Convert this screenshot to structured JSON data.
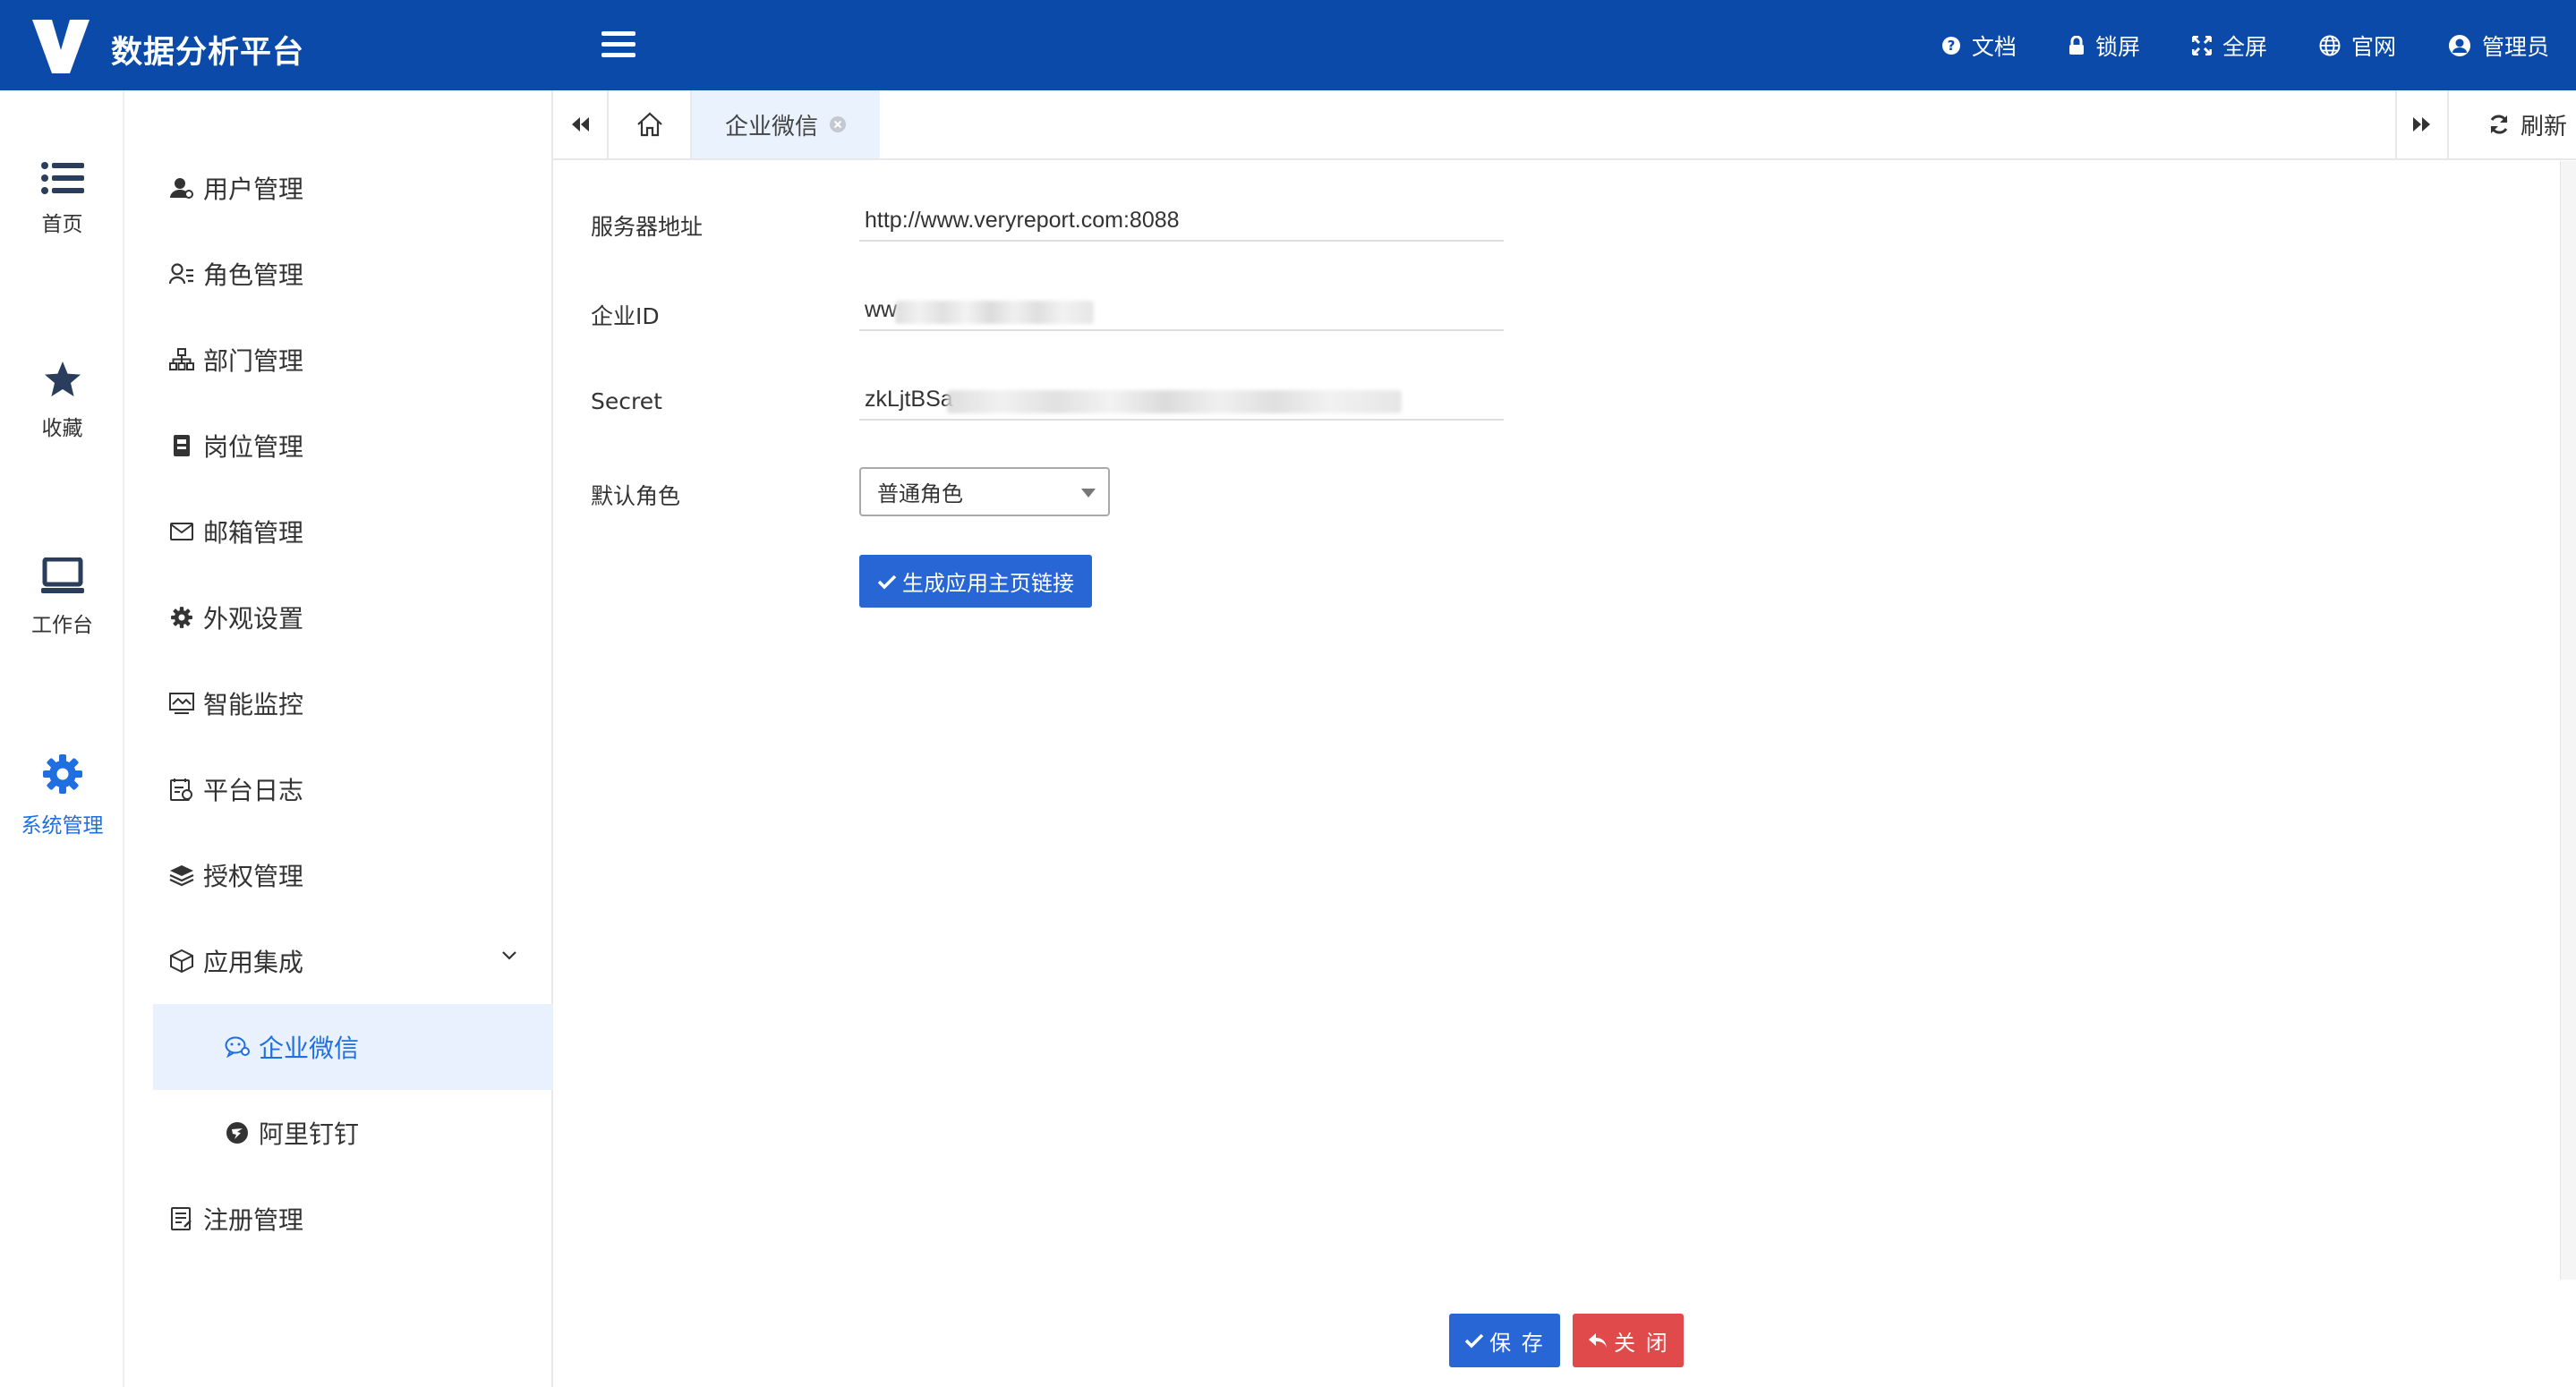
{
  "header": {
    "app_title": "数据分析平台",
    "actions": [
      "文档",
      "锁屏",
      "全屏",
      "官网",
      "管理员"
    ],
    "background": "#0b4aa8"
  },
  "rail": {
    "items": [
      {
        "label": "首页",
        "icon": "list-icon"
      },
      {
        "label": "收藏",
        "icon": "star-icon"
      },
      {
        "label": "工作台",
        "icon": "laptop-icon"
      },
      {
        "label": "系统管理",
        "icon": "gear-icon"
      }
    ],
    "active": "系统管理",
    "active_color": "#1f6fe0"
  },
  "submenu": {
    "items": [
      {
        "label": "用户管理",
        "icon": "user-icon"
      },
      {
        "label": "角色管理",
        "icon": "role-icon"
      },
      {
        "label": "部门管理",
        "icon": "org-chart-icon"
      },
      {
        "label": "岗位管理",
        "icon": "badge-icon"
      },
      {
        "label": "邮箱管理",
        "icon": "mail-icon"
      },
      {
        "label": "外观设置",
        "icon": "cog-icon"
      },
      {
        "label": "智能监控",
        "icon": "monitor-icon"
      },
      {
        "label": "平台日志",
        "icon": "log-icon"
      },
      {
        "label": "授权管理",
        "icon": "layers-icon"
      },
      {
        "label": "应用集成",
        "icon": "cube-icon"
      },
      {
        "label": "企业微信",
        "icon": "wechat-icon"
      },
      {
        "label": "阿里钉钉",
        "icon": "dingtalk-icon"
      },
      {
        "label": "注册管理",
        "icon": "register-icon"
      }
    ],
    "active": "企业微信"
  },
  "tabs": {
    "active_tab": "企业微信",
    "refresh_label": "刷新"
  },
  "form": {
    "server_label": "服务器地址",
    "server_value": "http://www.veryreport.com:8088",
    "corp_id_label": "企业ID",
    "corp_id_value": "ww",
    "secret_label": "Secret",
    "secret_value": "zkLjtBSa",
    "role_label": "默认角色",
    "role_value": "普通角色",
    "generate_button": "生成应用主页链接"
  },
  "footer": {
    "save_label": "保 存",
    "close_label": "关 闭",
    "save_color": "#2866d6",
    "close_color": "#e04a4a"
  }
}
